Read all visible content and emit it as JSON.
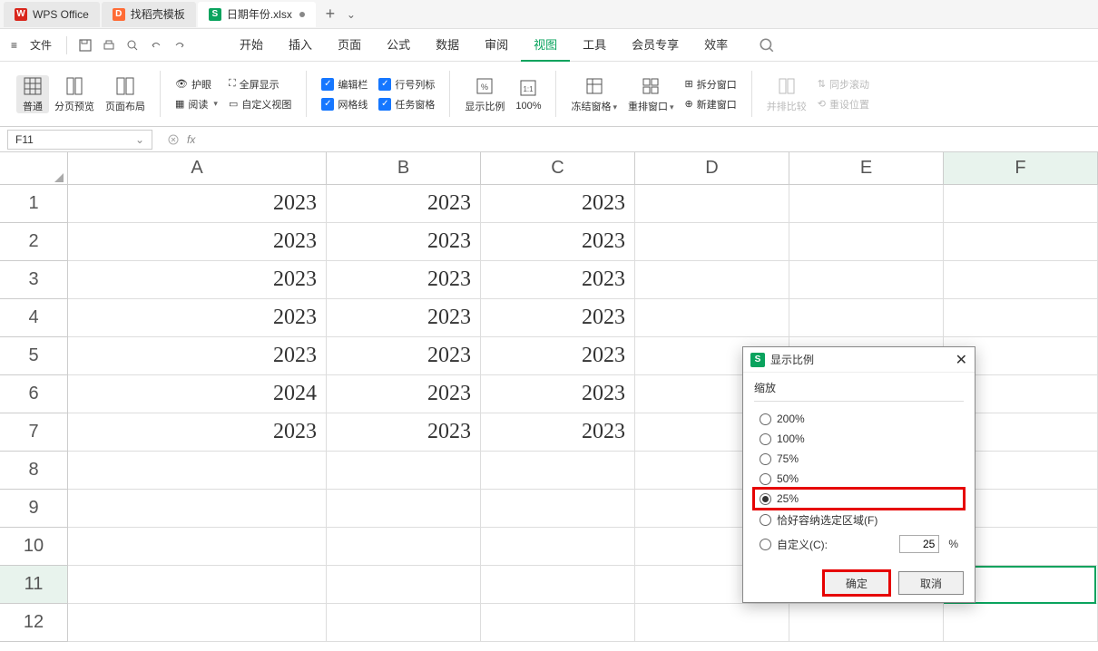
{
  "tabs": {
    "wps": "WPS Office",
    "dk": "找稻壳模板",
    "file": "日期年份.xlsx"
  },
  "menubar": {
    "file": "文件",
    "items": [
      "开始",
      "插入",
      "页面",
      "公式",
      "数据",
      "审阅",
      "视图",
      "工具",
      "会员专享",
      "效率"
    ],
    "active_index": 6
  },
  "ribbon": {
    "view_normal": "普通",
    "view_pagebreak": "分页预览",
    "view_pagelayout": "页面布局",
    "eye": "护眼",
    "read": "阅读",
    "fullscreen": "全屏显示",
    "customview": "自定义视图",
    "editbar": "编辑栏",
    "gridlines": "网格线",
    "rowcolhead": "行号列标",
    "taskpane": "任务窗格",
    "zoom_label": "显示比例",
    "zoom_val": "100%",
    "freeze": "冻结窗格",
    "arrange": "重排窗口",
    "split": "拆分窗口",
    "newwin": "新建窗口",
    "sidebyside": "并排比较",
    "syncscroll": "同步滚动",
    "resetpos": "重设位置"
  },
  "fx": {
    "namebox": "F11"
  },
  "sheet": {
    "cols": [
      "A",
      "B",
      "C",
      "D",
      "E",
      "F"
    ],
    "rows": [
      {
        "n": "1",
        "a": "2023",
        "b": "2023",
        "c": "2023"
      },
      {
        "n": "2",
        "a": "2023",
        "b": "2023",
        "c": "2023"
      },
      {
        "n": "3",
        "a": "2023",
        "b": "2023",
        "c": "2023"
      },
      {
        "n": "4",
        "a": "2023",
        "b": "2023",
        "c": "2023"
      },
      {
        "n": "5",
        "a": "2023",
        "b": "2023",
        "c": "2023"
      },
      {
        "n": "6",
        "a": "2024",
        "b": "2023",
        "c": "2023"
      },
      {
        "n": "7",
        "a": "2023",
        "b": "2023",
        "c": "2023"
      },
      {
        "n": "8",
        "a": "",
        "b": "",
        "c": ""
      },
      {
        "n": "9",
        "a": "",
        "b": "",
        "c": ""
      },
      {
        "n": "10",
        "a": "",
        "b": "",
        "c": ""
      },
      {
        "n": "11",
        "a": "",
        "b": "",
        "c": ""
      },
      {
        "n": "12",
        "a": "",
        "b": "",
        "c": ""
      }
    ]
  },
  "dialog": {
    "title": "显示比例",
    "group": "缩放",
    "o200": "200%",
    "o100": "100%",
    "o75": "75%",
    "o50": "50%",
    "o25": "25%",
    "fit": "恰好容纳选定区域(F)",
    "custom": "自定义(C):",
    "custom_val": "25",
    "pct": "%",
    "ok": "确定",
    "cancel": "取消"
  }
}
